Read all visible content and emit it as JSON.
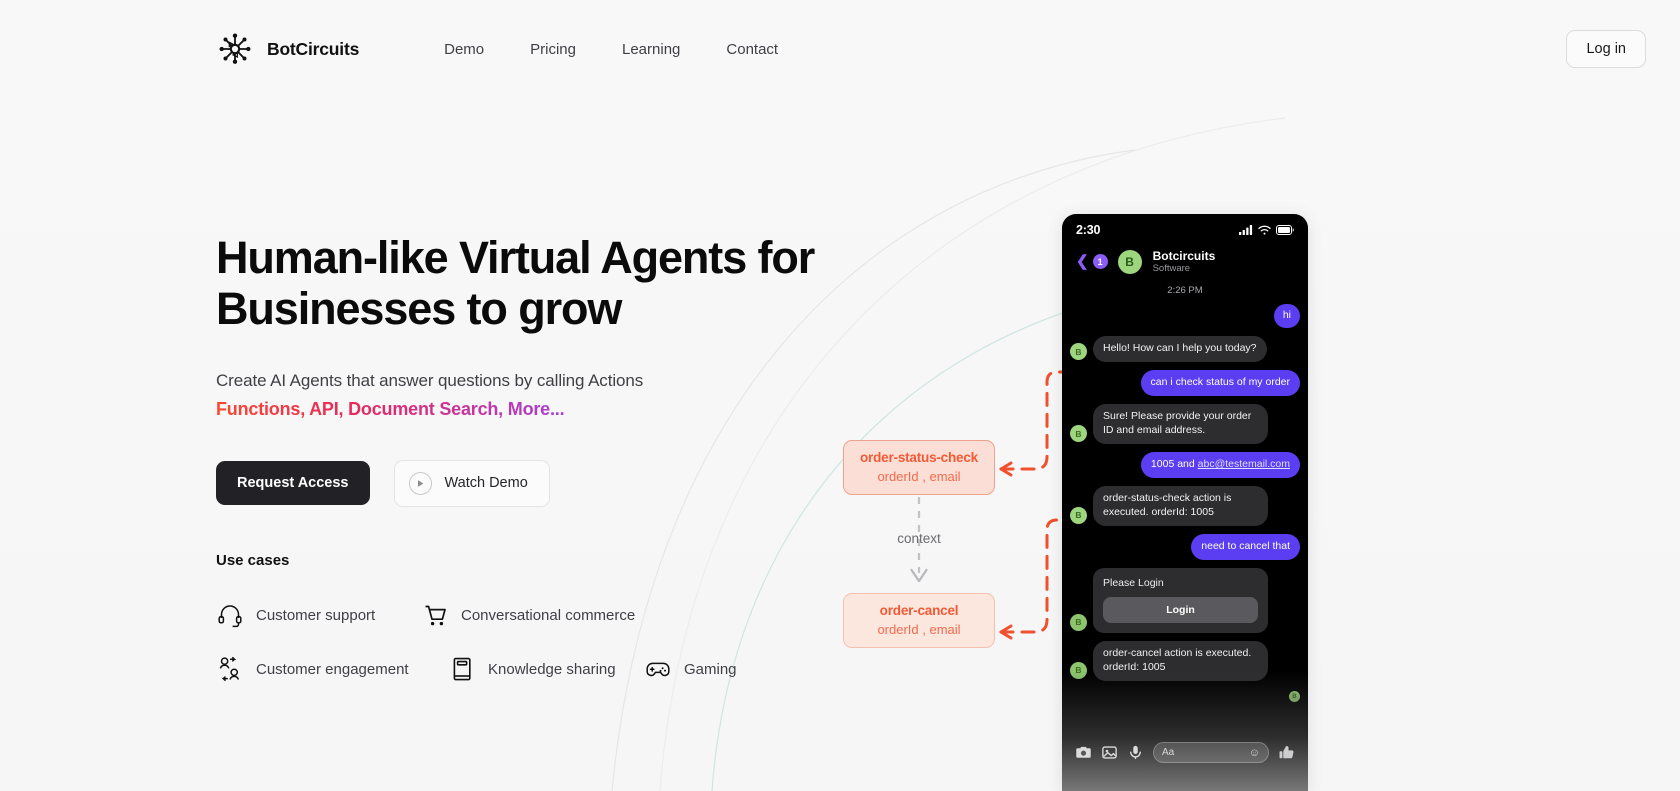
{
  "header": {
    "brand": "BotCircuits",
    "logo_icon": "circuit-node-icon",
    "nav": [
      {
        "label": "Demo"
      },
      {
        "label": "Pricing"
      },
      {
        "label": "Learning"
      },
      {
        "label": "Contact"
      }
    ],
    "login_label": "Log in"
  },
  "hero": {
    "title_line1": "Human-like Virtual Agents for",
    "title_line2": "Businesses to grow",
    "subtitle": "Create AI Agents that answer questions by calling Actions",
    "gradient_line": "Functions, API, Document Search, More...",
    "gradient_from": "#f9492f",
    "gradient_to": "#a73fd4",
    "primary_cta": "Request Access",
    "secondary_cta": "Watch Demo",
    "play_icon": "play-icon"
  },
  "use_cases": {
    "title": "Use cases",
    "items": [
      {
        "label": "Customer support",
        "icon": "headset-icon"
      },
      {
        "label": "Conversational commerce",
        "icon": "shopping-cart-icon"
      },
      {
        "label": "Customer engagement",
        "icon": "users-exchange-icon"
      },
      {
        "label": "Knowledge sharing",
        "icon": "book-icon"
      },
      {
        "label": "Gaming",
        "icon": "gamepad-icon"
      }
    ]
  },
  "flow": {
    "accent": "#f05a35",
    "nodes": [
      {
        "name": "order-status-check",
        "args": "orderId , email"
      },
      {
        "name": "order-cancel",
        "args": "orderId , email"
      }
    ],
    "edge_label": "context"
  },
  "phone": {
    "status": {
      "time": "2:30",
      "signal_icon": "cellular-icon",
      "wifi_icon": "wifi-icon",
      "battery_icon": "battery-icon"
    },
    "chat_header": {
      "back_icon": "chevron-left-icon",
      "unread_count": "1",
      "avatar_initial": "B",
      "title": "Botcircuits",
      "subtitle": "Software"
    },
    "timestamp": "2:26 PM",
    "messages": [
      {
        "side": "out",
        "text": "hi",
        "kind": "text"
      },
      {
        "side": "in",
        "text": "Hello! How can I help you today?",
        "kind": "text",
        "avatar": "B"
      },
      {
        "side": "out",
        "text": "can i check status of my order",
        "kind": "text"
      },
      {
        "side": "in",
        "text": "Sure! Please provide your order ID and email address.",
        "kind": "text",
        "avatar": "B"
      },
      {
        "side": "out",
        "text": "1005 and ",
        "link": "abc@testemail.com",
        "kind": "link"
      },
      {
        "side": "in",
        "text": "order-status-check action is executed. orderId: 1005",
        "kind": "text",
        "avatar": "B"
      },
      {
        "side": "out",
        "text": "need to cancel that",
        "kind": "text"
      },
      {
        "side": "in",
        "text": "Please Login",
        "button": "Login",
        "kind": "card",
        "avatar": "B"
      },
      {
        "side": "in",
        "text": "order-cancel action is executed. orderId: 1005",
        "kind": "text",
        "avatar": "B"
      }
    ],
    "composer": {
      "camera_icon": "camera-icon",
      "gallery_icon": "image-icon",
      "mic_icon": "microphone-icon",
      "placeholder": "Aa",
      "emoji_icon": "smiley-icon",
      "thumb_icon": "thumbs-up-icon"
    }
  }
}
